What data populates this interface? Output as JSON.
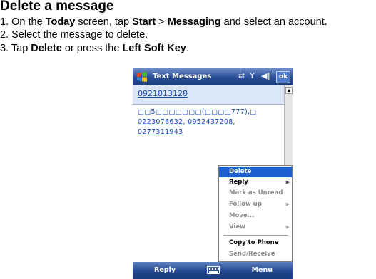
{
  "document": {
    "title": "Delete a message",
    "steps": [
      {
        "n": "1.",
        "parts": [
          "On the ",
          "Today",
          " screen, tap ",
          "Start",
          " > ",
          "Messaging",
          " and select an account."
        ]
      },
      {
        "n": "2.",
        "text": "Select the message to delete."
      },
      {
        "n": "3.",
        "parts": [
          "Tap ",
          "Delete",
          " or press the ",
          "Left Soft Key",
          "."
        ]
      }
    ]
  },
  "phone": {
    "app_title": "Text Messages",
    "ok_label": "ok",
    "sender": "0921813128",
    "body_line1": "□□5□□□□□□□(□□□□777),□",
    "body_link1": "0223076632",
    "body_sep1": ", ",
    "body_link2": "0952437208",
    "body_sep2": ",",
    "body_link3": "0277311943",
    "icons": {
      "start": "windows-flag-icon",
      "signal": "connectivity-icon",
      "antenna": "antenna-icon",
      "speaker": "speaker-icon"
    },
    "menu": {
      "items": [
        {
          "label": "Delete",
          "selected": true,
          "disabled": false,
          "submenu": false
        },
        {
          "label": "Reply",
          "selected": false,
          "disabled": false,
          "submenu": true
        },
        {
          "label": "Mark as Unread",
          "selected": false,
          "disabled": true,
          "submenu": false
        },
        {
          "label": "Follow up",
          "selected": false,
          "disabled": true,
          "submenu": true
        },
        {
          "label": "Move...",
          "selected": false,
          "disabled": true,
          "submenu": false
        },
        {
          "label": "View",
          "selected": false,
          "disabled": true,
          "submenu": true
        },
        {
          "label": "Copy to Phone",
          "selected": false,
          "disabled": false,
          "submenu": false
        },
        {
          "label": "Send/Receive",
          "selected": false,
          "disabled": true,
          "submenu": false
        }
      ]
    },
    "softkeys": {
      "left": "Reply",
      "right": "Menu"
    },
    "colors": {
      "titlebar": "#274c95",
      "selection": "#1d5fcf",
      "link": "#1447b8",
      "header": "#dbe7f7"
    }
  }
}
